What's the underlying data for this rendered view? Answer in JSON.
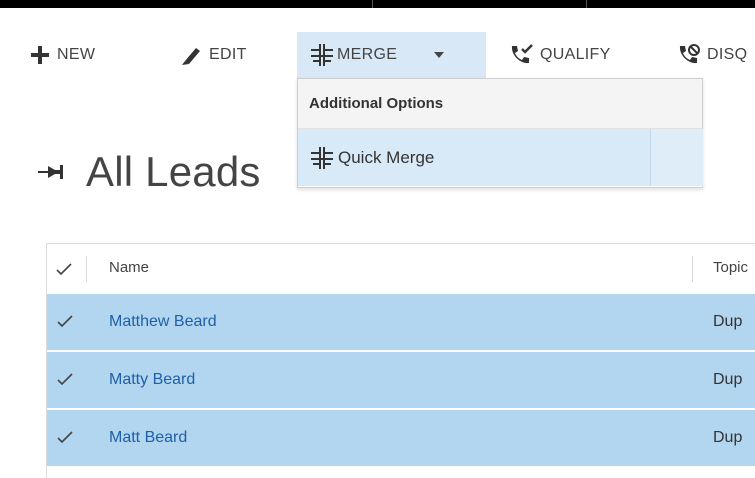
{
  "command_bar": {
    "new_label": "NEW",
    "edit_label": "EDIT",
    "merge_label": "MERGE",
    "qualify_label": "QUALIFY",
    "disqualify_label": "DISQ"
  },
  "merge_menu": {
    "header": "Additional Options",
    "items": [
      {
        "label": "Quick Merge",
        "icon": "merge-icon"
      }
    ]
  },
  "view": {
    "title": "All Leads"
  },
  "grid": {
    "columns": [
      "Name",
      "Topic"
    ],
    "rows": [
      {
        "name": "Matthew Beard",
        "topic": "Dup",
        "selected": true
      },
      {
        "name": "Matty Beard",
        "topic": "Dup",
        "selected": true
      },
      {
        "name": "Matt Beard",
        "topic": "Dup",
        "selected": true
      }
    ]
  },
  "colors": {
    "selected_row": "#b2d6f0",
    "link": "#1f5fa8",
    "menu_highlight": "#d8e9f7"
  }
}
